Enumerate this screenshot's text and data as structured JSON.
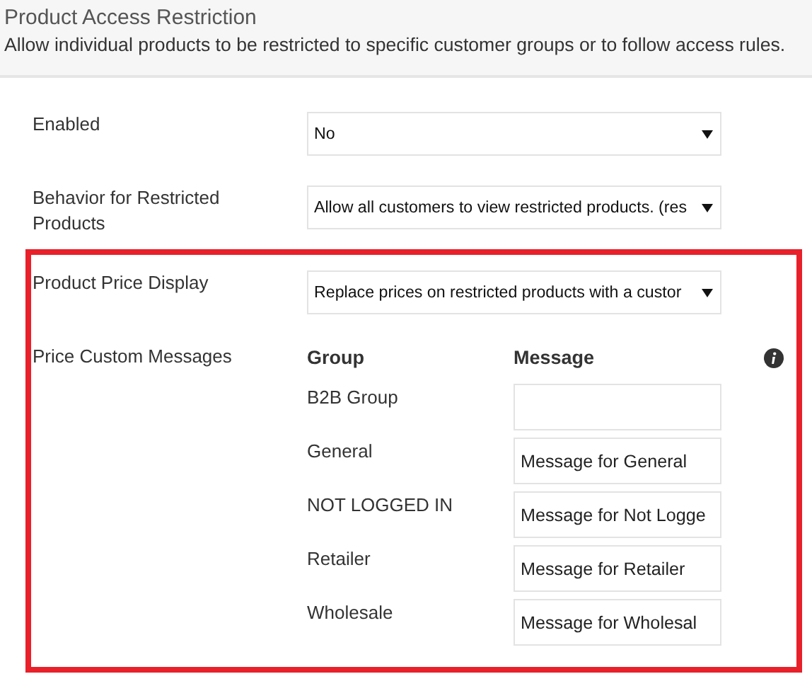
{
  "header": {
    "title": "Product Access Restriction",
    "description": "Allow individual products to be restricted to specific customer groups or to follow access rules."
  },
  "settings": [
    {
      "label": "Enabled",
      "value": "No",
      "highlighted": false
    },
    {
      "label": "Behavior for Restricted Products",
      "value": "Allow all customers to view restricted products. (res",
      "highlighted": false
    },
    {
      "label": "Product Price Display",
      "value": "Replace prices on restricted products with a custor",
      "highlighted": true
    }
  ],
  "custom_messages": {
    "label": "Price Custom Messages",
    "columns": [
      "Group",
      "Message"
    ],
    "rows": [
      {
        "group": "B2B Group",
        "message": ""
      },
      {
        "group": "General",
        "message": "Message for General"
      },
      {
        "group": "NOT LOGGED IN",
        "message": "Message for Not Logge"
      },
      {
        "group": "Retailer",
        "message": "Message for Retailer"
      },
      {
        "group": "Wholesale",
        "message": "Message for Wholesal"
      }
    ]
  }
}
